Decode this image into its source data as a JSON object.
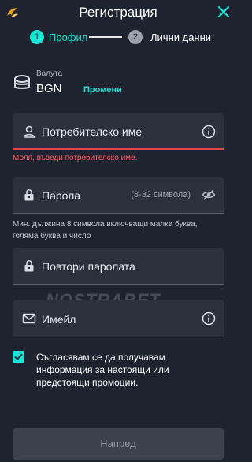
{
  "header": {
    "title": "Регистрация",
    "logo_icon": "brand-logo-icon",
    "close_icon": "close-icon"
  },
  "steps": [
    {
      "number": "1",
      "label": "Профил",
      "active": true
    },
    {
      "number": "2",
      "label": "Лични данни",
      "active": false
    }
  ],
  "currency": {
    "label": "Валута",
    "value": "BGN",
    "change_label": "Промени"
  },
  "form": {
    "username": {
      "placeholder": "Потребителско име",
      "error": "Моля, въведи потребителско име."
    },
    "password": {
      "placeholder": "Парола",
      "hint": "(8-32 символа)",
      "helper": "Мин. дължина 8 символа включващи малка буква, голяма буква и число"
    },
    "repeat_password": {
      "placeholder": "Повтори паролата"
    },
    "email": {
      "placeholder": "Имейл"
    }
  },
  "watermark": "NOSTRABET",
  "consent": {
    "checked": true,
    "text": "Съгласявам се да получавам информация за настоящи или предстоящи промоции."
  },
  "next_button": {
    "label": "Напред"
  },
  "colors": {
    "accent": "#1de3d4",
    "error": "#e2454a",
    "background": "#1f2330"
  }
}
